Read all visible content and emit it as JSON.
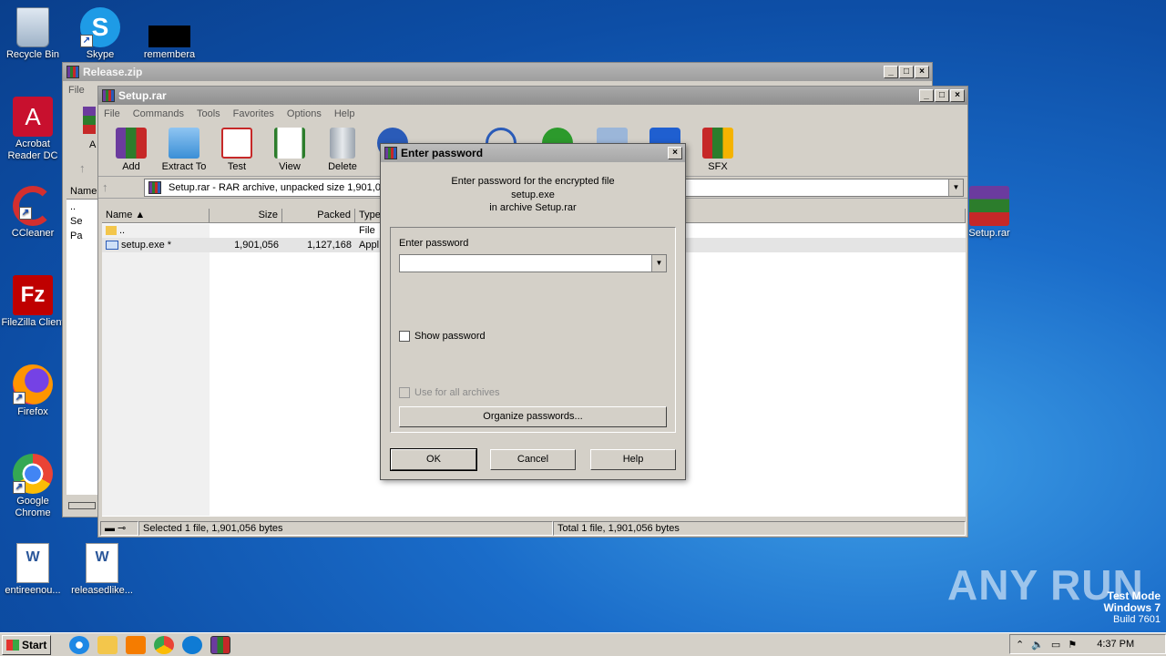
{
  "desktop": {
    "icons": [
      {
        "label": "Recycle Bin",
        "icon": "recycle-bin-icon"
      },
      {
        "label": "Skype",
        "icon": "skype-icon"
      },
      {
        "label": "remembera",
        "icon": "redacted-file-icon"
      },
      {
        "label": "Acrobat Reader DC",
        "icon": "acrobat-icon"
      },
      {
        "label": "CCleaner",
        "icon": "ccleaner-icon"
      },
      {
        "label": "FileZilla Client",
        "icon": "filezilla-icon"
      },
      {
        "label": "Firefox",
        "icon": "firefox-icon"
      },
      {
        "label": "Google Chrome",
        "icon": "chrome-icon"
      },
      {
        "label": "entireenou...",
        "icon": "word-doc-icon"
      },
      {
        "label": "releasedlike...",
        "icon": "word-doc-icon"
      },
      {
        "label": "Setup.rar",
        "icon": "winrar-archive-icon"
      }
    ],
    "watermark": "ANY RUN",
    "testmode": {
      "line1": "Test Mode",
      "line2": "Windows 7",
      "line3": "Build 7601"
    }
  },
  "back_window": {
    "title": "Release.zip",
    "menu": [
      "File"
    ],
    "partial_rows": [
      "..",
      "Se",
      "Pa"
    ],
    "col_name": "Name",
    "tool_letter": "A"
  },
  "main_window": {
    "title": "Setup.rar",
    "menu": [
      "File",
      "Commands",
      "Tools",
      "Favorites",
      "Options",
      "Help"
    ],
    "toolbar": [
      "Add",
      "Extract To",
      "Test",
      "View",
      "Delete",
      "SFX"
    ],
    "address": "Setup.rar - RAR archive, unpacked size 1,901,05",
    "columns": [
      "Name",
      "Size",
      "Packed",
      "Type"
    ],
    "rows": [
      {
        "name": "..",
        "size": "",
        "packed": "",
        "type": "File"
      },
      {
        "name": "setup.exe *",
        "size": "1,901,056",
        "packed": "1,127,168",
        "type": "Appl"
      }
    ],
    "status_left": "Selected 1 file, 1,901,056 bytes",
    "status_right": "Total 1 file, 1,901,056 bytes"
  },
  "dialog": {
    "title": "Enter password",
    "message_line1": "Enter password for the encrypted file",
    "message_line2": "setup.exe",
    "message_line3": "in archive Setup.rar",
    "field_label": "Enter password",
    "password_value": "",
    "show_password_label": "Show password",
    "use_for_all_label": "Use for all archives",
    "organize_label": "Organize passwords...",
    "ok_label": "OK",
    "cancel_label": "Cancel",
    "help_label": "Help"
  },
  "taskbar": {
    "start_label": "Start",
    "clock": "4:37 PM"
  }
}
